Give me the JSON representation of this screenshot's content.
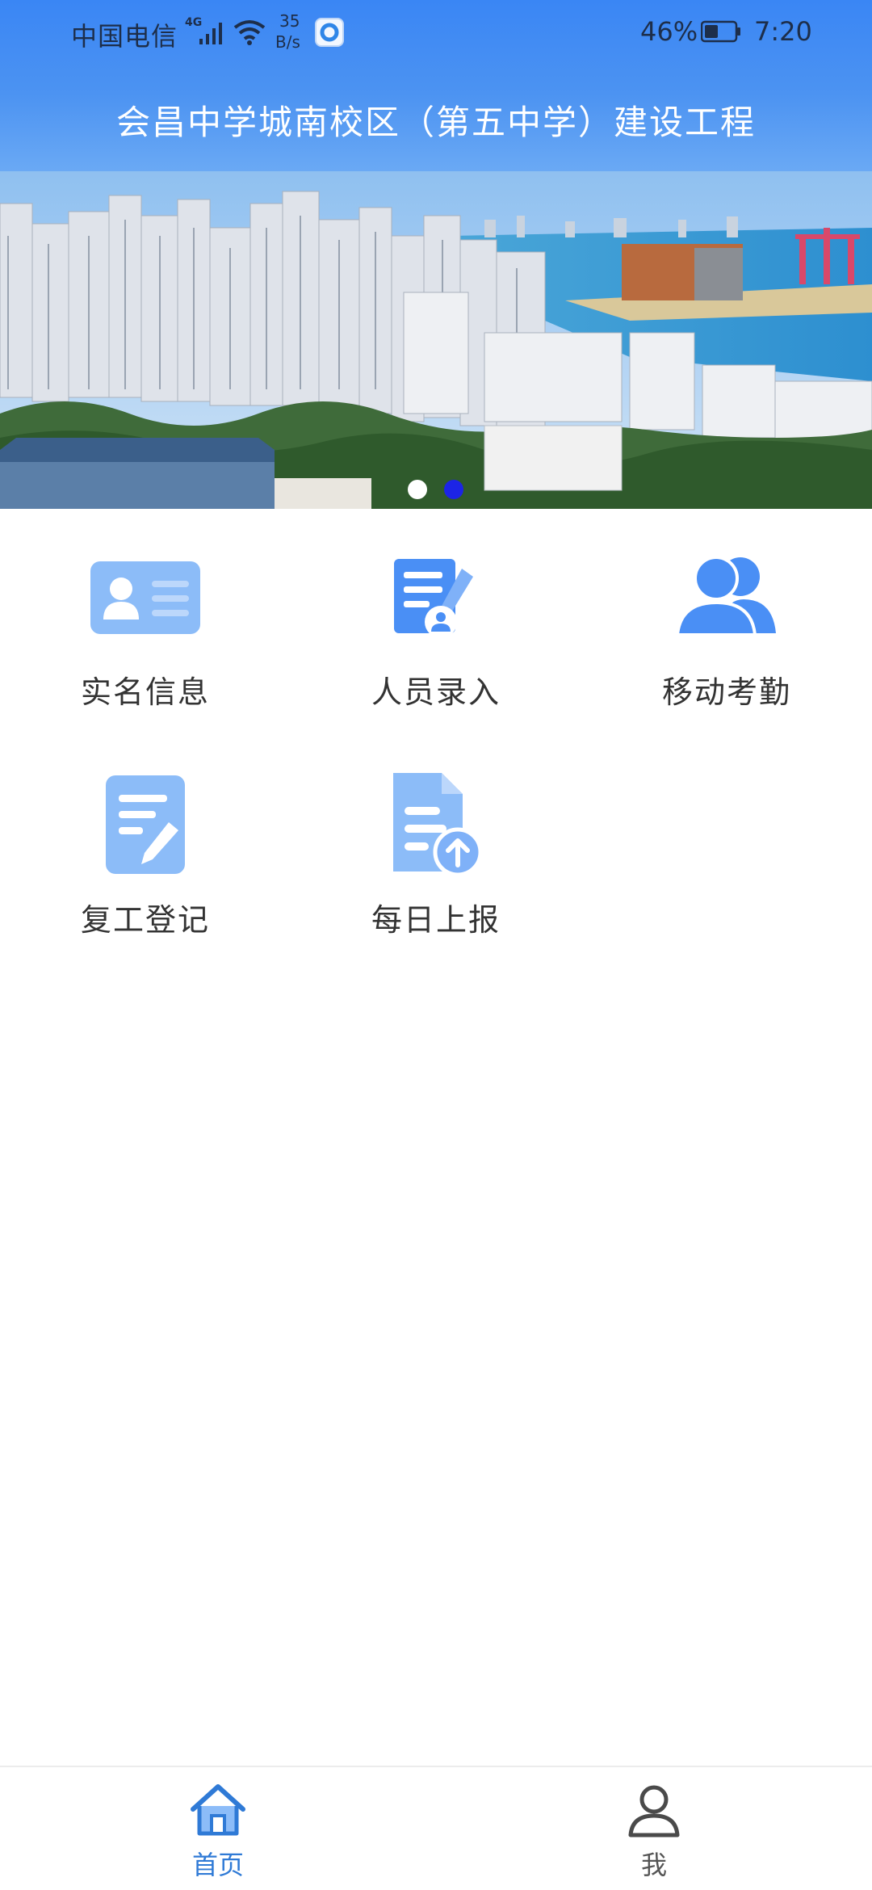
{
  "status_bar": {
    "carrier": "中国电信",
    "network_type": "4G",
    "speed_value": "35",
    "speed_unit": "B/s",
    "battery_percent": "46%",
    "battery_level": 0.46,
    "time": "7:20"
  },
  "header": {
    "title": "会昌中学城南校区（第五中学）建设工程"
  },
  "banner": {
    "slide_count": 2,
    "active_slide": 2
  },
  "menu": {
    "items": [
      {
        "label": "实名信息",
        "icon": "id-card-icon"
      },
      {
        "label": "人员录入",
        "icon": "document-edit-person-icon"
      },
      {
        "label": "移动考勤",
        "icon": "people-group-icon"
      },
      {
        "label": "复工登记",
        "icon": "form-pen-icon"
      },
      {
        "label": "每日上报",
        "icon": "document-upload-icon"
      }
    ]
  },
  "bottom_nav": {
    "items": [
      {
        "label": "首页",
        "icon": "home-icon",
        "active": true
      },
      {
        "label": "我",
        "icon": "user-icon",
        "active": false
      }
    ]
  },
  "colors": {
    "header_blue": "#3a86f4",
    "icon_blue": "#4a8ff5",
    "icon_light_blue": "#7fb1f8",
    "active_nav": "#2f7ad6",
    "active_dot": "#1c24e6"
  }
}
